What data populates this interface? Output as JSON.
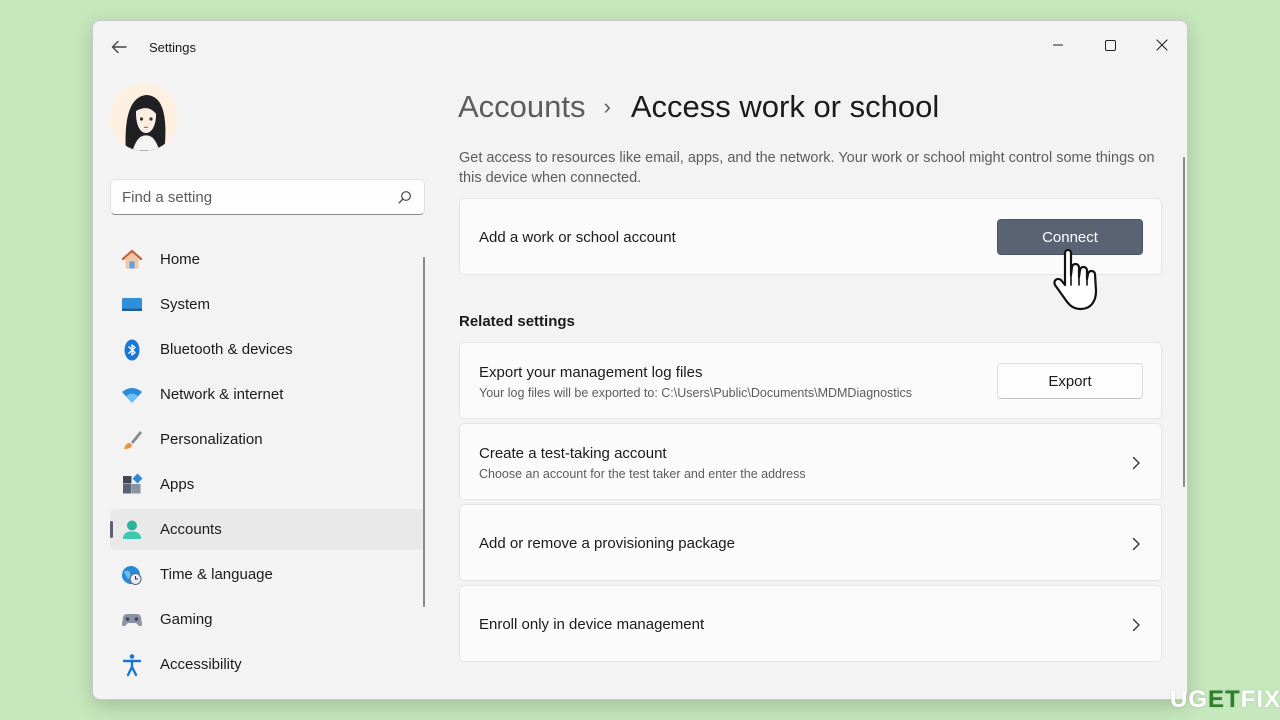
{
  "window": {
    "title": "Settings"
  },
  "search": {
    "placeholder": "Find a setting"
  },
  "sidebar": {
    "items": [
      {
        "label": "Home",
        "icon": "home-icon"
      },
      {
        "label": "System",
        "icon": "system-icon"
      },
      {
        "label": "Bluetooth & devices",
        "icon": "bluetooth-icon"
      },
      {
        "label": "Network & internet",
        "icon": "wifi-icon"
      },
      {
        "label": "Personalization",
        "icon": "brush-icon"
      },
      {
        "label": "Apps",
        "icon": "apps-icon"
      },
      {
        "label": "Accounts",
        "icon": "accounts-icon",
        "selected": true
      },
      {
        "label": "Time & language",
        "icon": "globe-clock-icon"
      },
      {
        "label": "Gaming",
        "icon": "gamepad-icon"
      },
      {
        "label": "Accessibility",
        "icon": "accessibility-icon"
      }
    ]
  },
  "breadcrumb": {
    "parent": "Accounts",
    "separator": "›",
    "current": "Access work or school"
  },
  "main": {
    "description": "Get access to resources like email, apps, and the network. Your work or school might control some things on this device when connected.",
    "add_account": {
      "title": "Add a work or school account",
      "button": "Connect"
    },
    "related_heading": "Related settings",
    "export": {
      "title": "Export your management log files",
      "subtitle": "Your log files will be exported to: C:\\Users\\Public\\Documents\\MDMDiagnostics",
      "button": "Export"
    },
    "test_account": {
      "title": "Create a test-taking account",
      "subtitle": "Choose an account for the test taker and enter the address"
    },
    "provisioning": {
      "title": "Add or remove a provisioning package"
    },
    "enroll": {
      "title": "Enroll only in device management"
    }
  },
  "colors": {
    "accent": "#5a6374",
    "background": "#c6e8bd",
    "window": "#f3f3f3",
    "card": "#fbfbfb"
  },
  "watermark": {
    "part1": "UG",
    "part2": "ET",
    "part3": "FIX"
  }
}
